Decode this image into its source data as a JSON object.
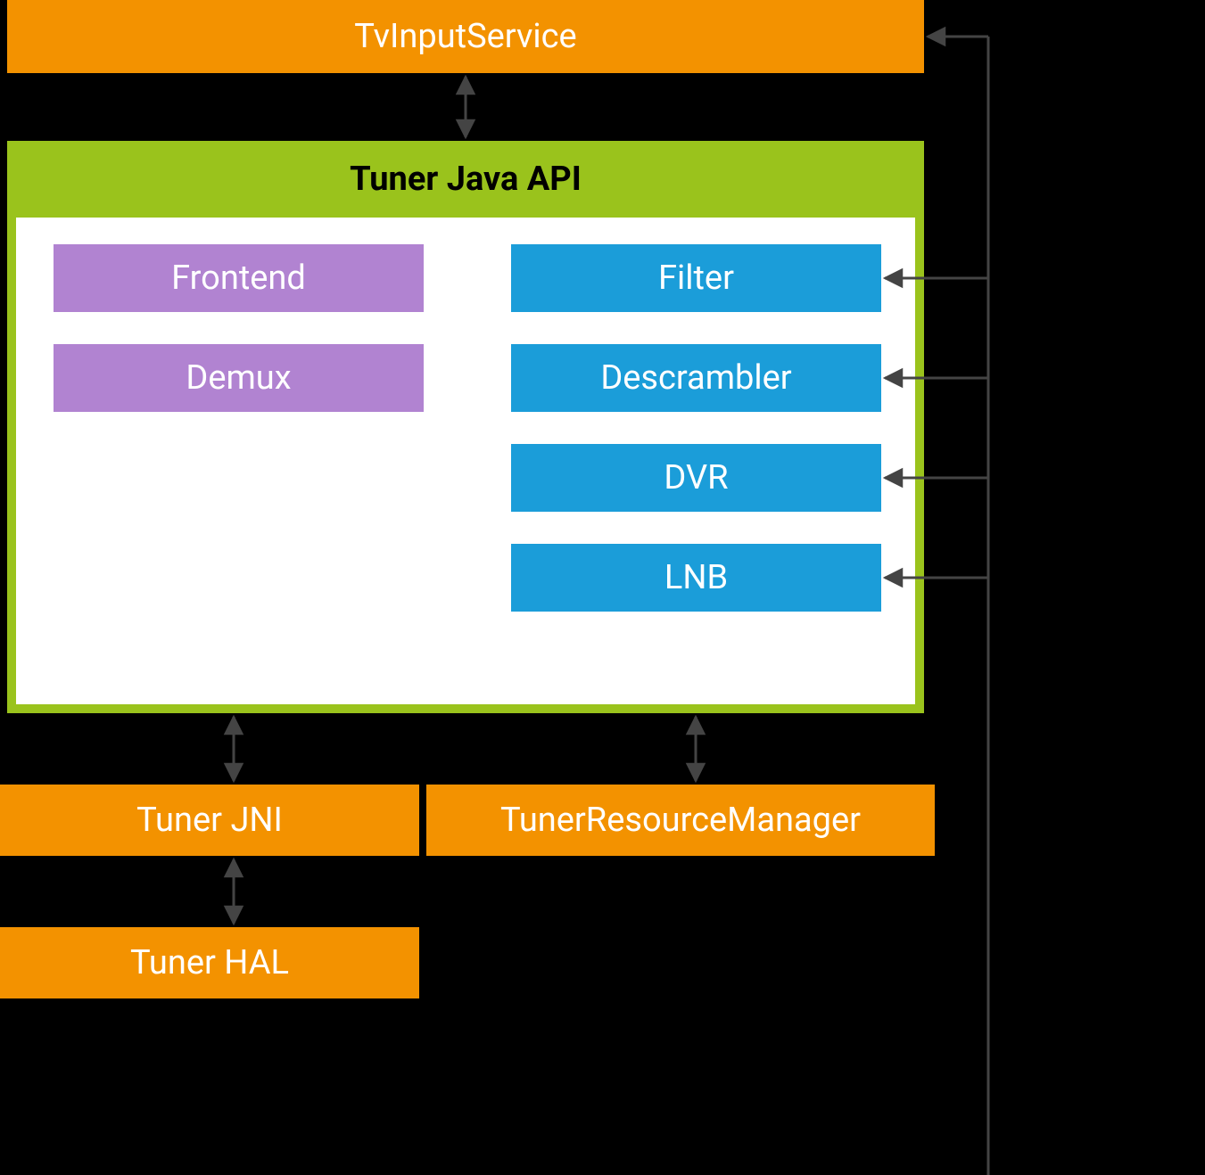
{
  "top": {
    "tvinput": "TvInputService"
  },
  "api": {
    "title": "Tuner Java API",
    "modules": {
      "frontend": "Frontend",
      "demux": "Demux",
      "filter": "Filter",
      "descrambler": "Descrambler",
      "dvr": "DVR",
      "lnb": "LNB"
    }
  },
  "bottom": {
    "jni": "Tuner JNI",
    "trm": "TunerResourceManager",
    "hal": "Tuner HAL"
  },
  "colors": {
    "orange": "#f39200",
    "green": "#9ac31c",
    "purple": "#b183d1",
    "blue": "#1b9dd9",
    "arrow": "#444444"
  }
}
